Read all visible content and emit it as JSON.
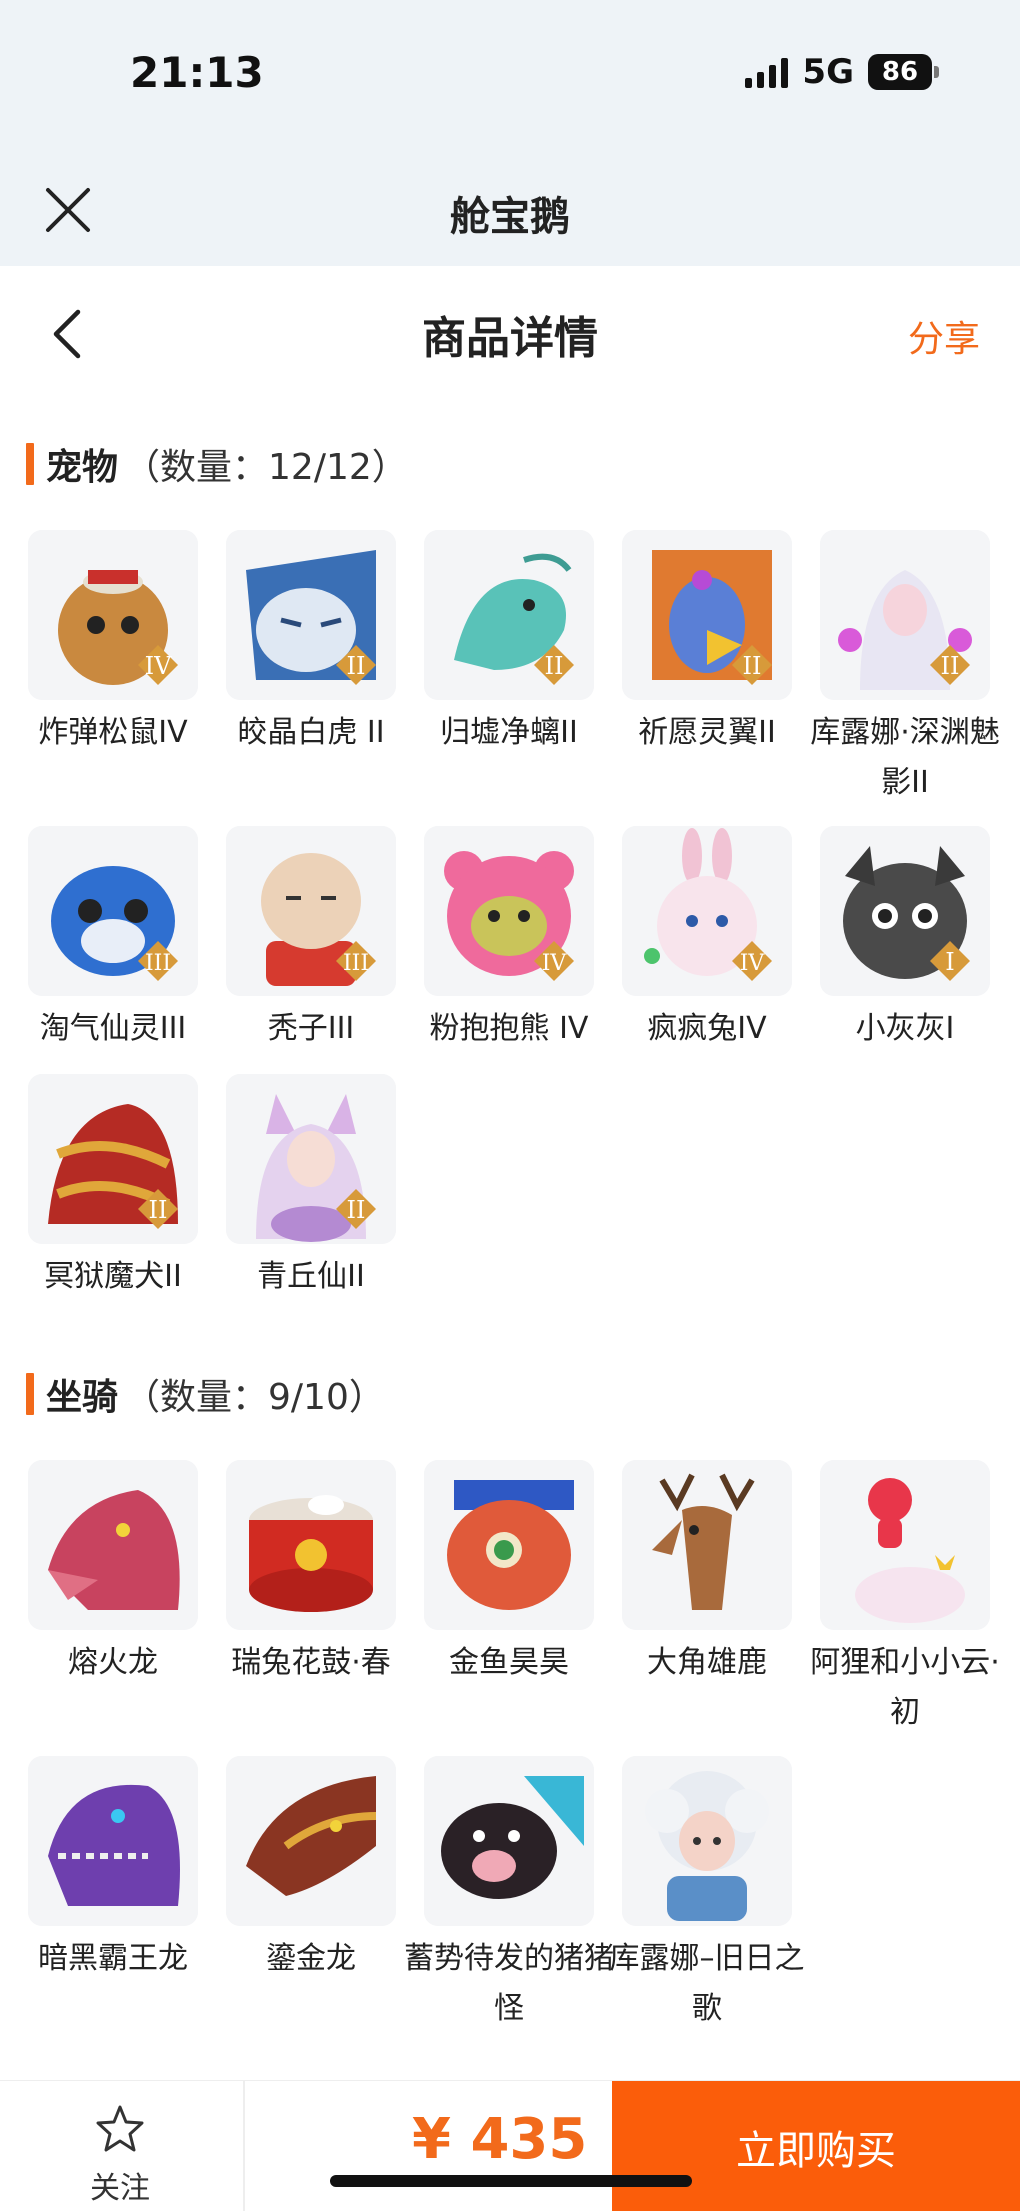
{
  "status_bar": {
    "time": "21:13",
    "network": "5G",
    "battery": "86"
  },
  "mini_program": {
    "title": "舱宝鹅"
  },
  "nav": {
    "title": "商品详情",
    "share_label": "分享"
  },
  "sections": [
    {
      "name": "宠物",
      "count": "（数量：12/12）",
      "items": [
        {
          "label": "炸弹松鼠IV",
          "badge": "IV"
        },
        {
          "label": "皎晶白虎 II",
          "badge": "II"
        },
        {
          "label": "归墟净螭II",
          "badge": "II"
        },
        {
          "label": "祈愿灵翼II",
          "badge": "II"
        },
        {
          "label": "库露娜·深渊魅影II",
          "badge": "II"
        },
        {
          "label": "淘气仙灵III",
          "badge": "III"
        },
        {
          "label": "秃子III",
          "badge": "III"
        },
        {
          "label": "粉抱抱熊 IV",
          "badge": "IV"
        },
        {
          "label": "疯疯兔IV",
          "badge": "IV"
        },
        {
          "label": "小灰灰I",
          "badge": "I"
        },
        {
          "label": "冥狱魔犬II",
          "badge": "II"
        },
        {
          "label": "青丘仙II",
          "badge": "II"
        }
      ]
    },
    {
      "name": "坐骑",
      "count": "（数量：9/10）",
      "items": [
        {
          "label": "熔火龙"
        },
        {
          "label": "瑞兔花鼓·春"
        },
        {
          "label": "金鱼昊昊"
        },
        {
          "label": "大角雄鹿"
        },
        {
          "label": "阿狸和小小云·初"
        },
        {
          "label": "暗黑霸王龙"
        },
        {
          "label": "鎏金龙"
        },
        {
          "label": "蓄势待发的猪猪怪"
        },
        {
          "label": "库露娜–旧日之歌"
        }
      ]
    }
  ],
  "bottom_bar": {
    "follow_label": "关注",
    "price": "¥ 435",
    "buy_label": "立即购买"
  },
  "colors": {
    "accent": "#f26a1b",
    "buy_button": "#fb5d0a",
    "header_bg": "#eef3f7"
  },
  "icons": {
    "close": "close-icon",
    "back": "back-arrow-icon",
    "follow": "star-icon"
  }
}
